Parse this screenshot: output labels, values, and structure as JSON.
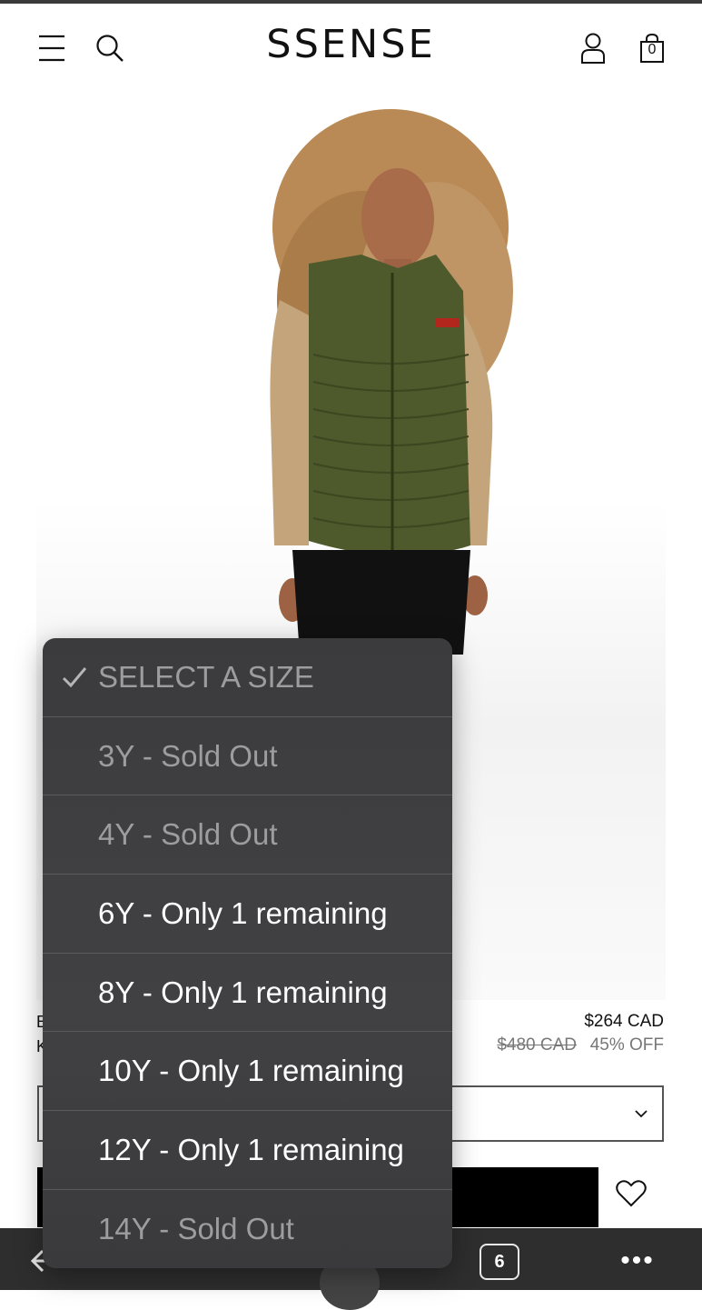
{
  "header": {
    "logo": "SSENSE",
    "bag_count": "0"
  },
  "product": {
    "price": "$264 CAD",
    "old_price": "$480 CAD",
    "discount": "45% OFF",
    "brand_partial_line1": "E",
    "brand_partial_line2": "K"
  },
  "size_dropdown": {
    "options": [
      {
        "label": "SELECT A SIZE",
        "selected": true,
        "available": false
      },
      {
        "label": "3Y - Sold Out",
        "selected": false,
        "available": false
      },
      {
        "label": "4Y - Sold Out",
        "selected": false,
        "available": false
      },
      {
        "label": "6Y - Only 1 remaining",
        "selected": false,
        "available": true
      },
      {
        "label": "8Y - Only 1 remaining",
        "selected": false,
        "available": true
      },
      {
        "label": "10Y - Only 1 remaining",
        "selected": false,
        "available": true
      },
      {
        "label": "12Y - Only 1 remaining",
        "selected": false,
        "available": true
      },
      {
        "label": "14Y - Sold Out",
        "selected": false,
        "available": false
      }
    ]
  },
  "browser": {
    "tab_count": "6",
    "more_label": "•••"
  }
}
